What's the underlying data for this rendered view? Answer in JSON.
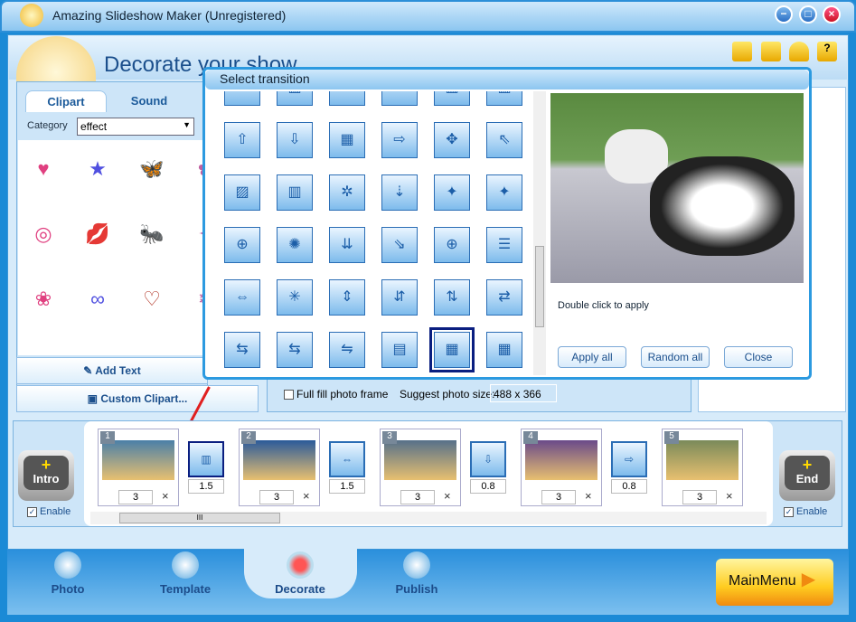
{
  "window": {
    "title": "Amazing Slideshow Maker (Unregistered)",
    "minimize": "−",
    "maximize": "□",
    "close": "×"
  },
  "header": {
    "title": "Decorate your show",
    "toolbar_icons": [
      "folder-icon",
      "save-icon",
      "user-icon",
      "help-icon"
    ]
  },
  "left_panel": {
    "tabs": [
      "Clipart",
      "Sound"
    ],
    "active_tab": "Clipart",
    "category_label": "Category",
    "category_value": "effect",
    "clips": [
      "♥",
      "★",
      "🦋",
      "✿",
      "◎",
      "💋",
      "🐜",
      "✦",
      "❀",
      "∞",
      "♡",
      "❄"
    ],
    "add_text": "Add Text",
    "custom_clipart": "Custom Clipart..."
  },
  "options": {
    "full_fill_label": "Full fill photo frame",
    "full_fill_checked": false,
    "suggest_label": "Suggest photo size:",
    "suggest_value": "488 x 366"
  },
  "dialog": {
    "title": "Select transition",
    "hint": "Double click to apply",
    "apply_all": "Apply all",
    "random_all": "Random all",
    "close": "Close",
    "tiles": [
      "▭",
      "▥",
      "⊥",
      "⊥",
      "▥",
      "▥",
      "⇧",
      "⇩",
      "▦",
      "⇨",
      "✥",
      "⇖",
      "▨",
      "▥",
      "✲",
      "⇣",
      "✦",
      "✦",
      "⊕",
      "✺",
      "⇊",
      "⇘",
      "⊕",
      "☰",
      "⇔",
      "✳",
      "⇕",
      "⇵",
      "⇅",
      "⇄",
      "⇆",
      "⇆",
      "⇋",
      "▤",
      "▦",
      "▦"
    ],
    "selected_index": 34
  },
  "timeline": {
    "intro": "Intro",
    "end": "End",
    "enable": "Enable",
    "intro_enabled": true,
    "end_enabled": true,
    "slides": [
      {
        "num": "1",
        "dur": "3",
        "color": "#4a7fa8"
      },
      {
        "num": "2",
        "dur": "3",
        "color": "#2a5a9a"
      },
      {
        "num": "3",
        "dur": "3",
        "color": "#56708a"
      },
      {
        "num": "4",
        "dur": "3",
        "color": "#6a4a8a"
      },
      {
        "num": "5",
        "dur": "3",
        "color": "#7a8a5a"
      }
    ],
    "transitions": [
      {
        "dur": "1.5",
        "icon": "▥"
      },
      {
        "dur": "1.5",
        "icon": "⇔"
      },
      {
        "dur": "0.8",
        "icon": "⇩"
      },
      {
        "dur": "0.8",
        "icon": "⇨"
      }
    ],
    "delete": "×",
    "scroll_grip": "III"
  },
  "nav": {
    "items": [
      "Photo",
      "Template",
      "Decorate",
      "Publish"
    ],
    "active": "Decorate",
    "main_menu": "MainMenu"
  }
}
